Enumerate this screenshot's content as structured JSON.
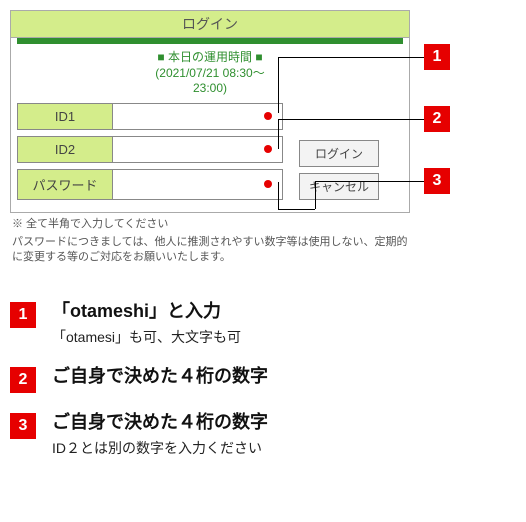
{
  "panel": {
    "title": "ログイン",
    "op_time_line1": "■ 本日の運用時間 ■",
    "op_time_line2": "(2021/07/21 08:30～",
    "op_time_line3": "23:00)",
    "fields": {
      "id1_label": "ID1",
      "id2_label": "ID2",
      "pw_label": "パスワード"
    },
    "buttons": {
      "login": "ログイン",
      "cancel": "キャンセル"
    },
    "note_half": "※ 全て半角で入力してください",
    "note_pw": "パスワードにつきましては、他人に推測されやすい数字等は使用しない、定期的に変更する等のご対応をお願いいたします。"
  },
  "callouts": {
    "n1": "1",
    "n2": "2",
    "n3": "3"
  },
  "explain": {
    "r1_main": "「otameshi」と入力",
    "r1_sub": "「otamesi」も可、大文字も可",
    "r2_main": "ご自身で決めた４桁の数字",
    "r3_main": "ご自身で決めた４桁の数字",
    "r3_sub": "ID２とは別の数字を入力ください"
  }
}
